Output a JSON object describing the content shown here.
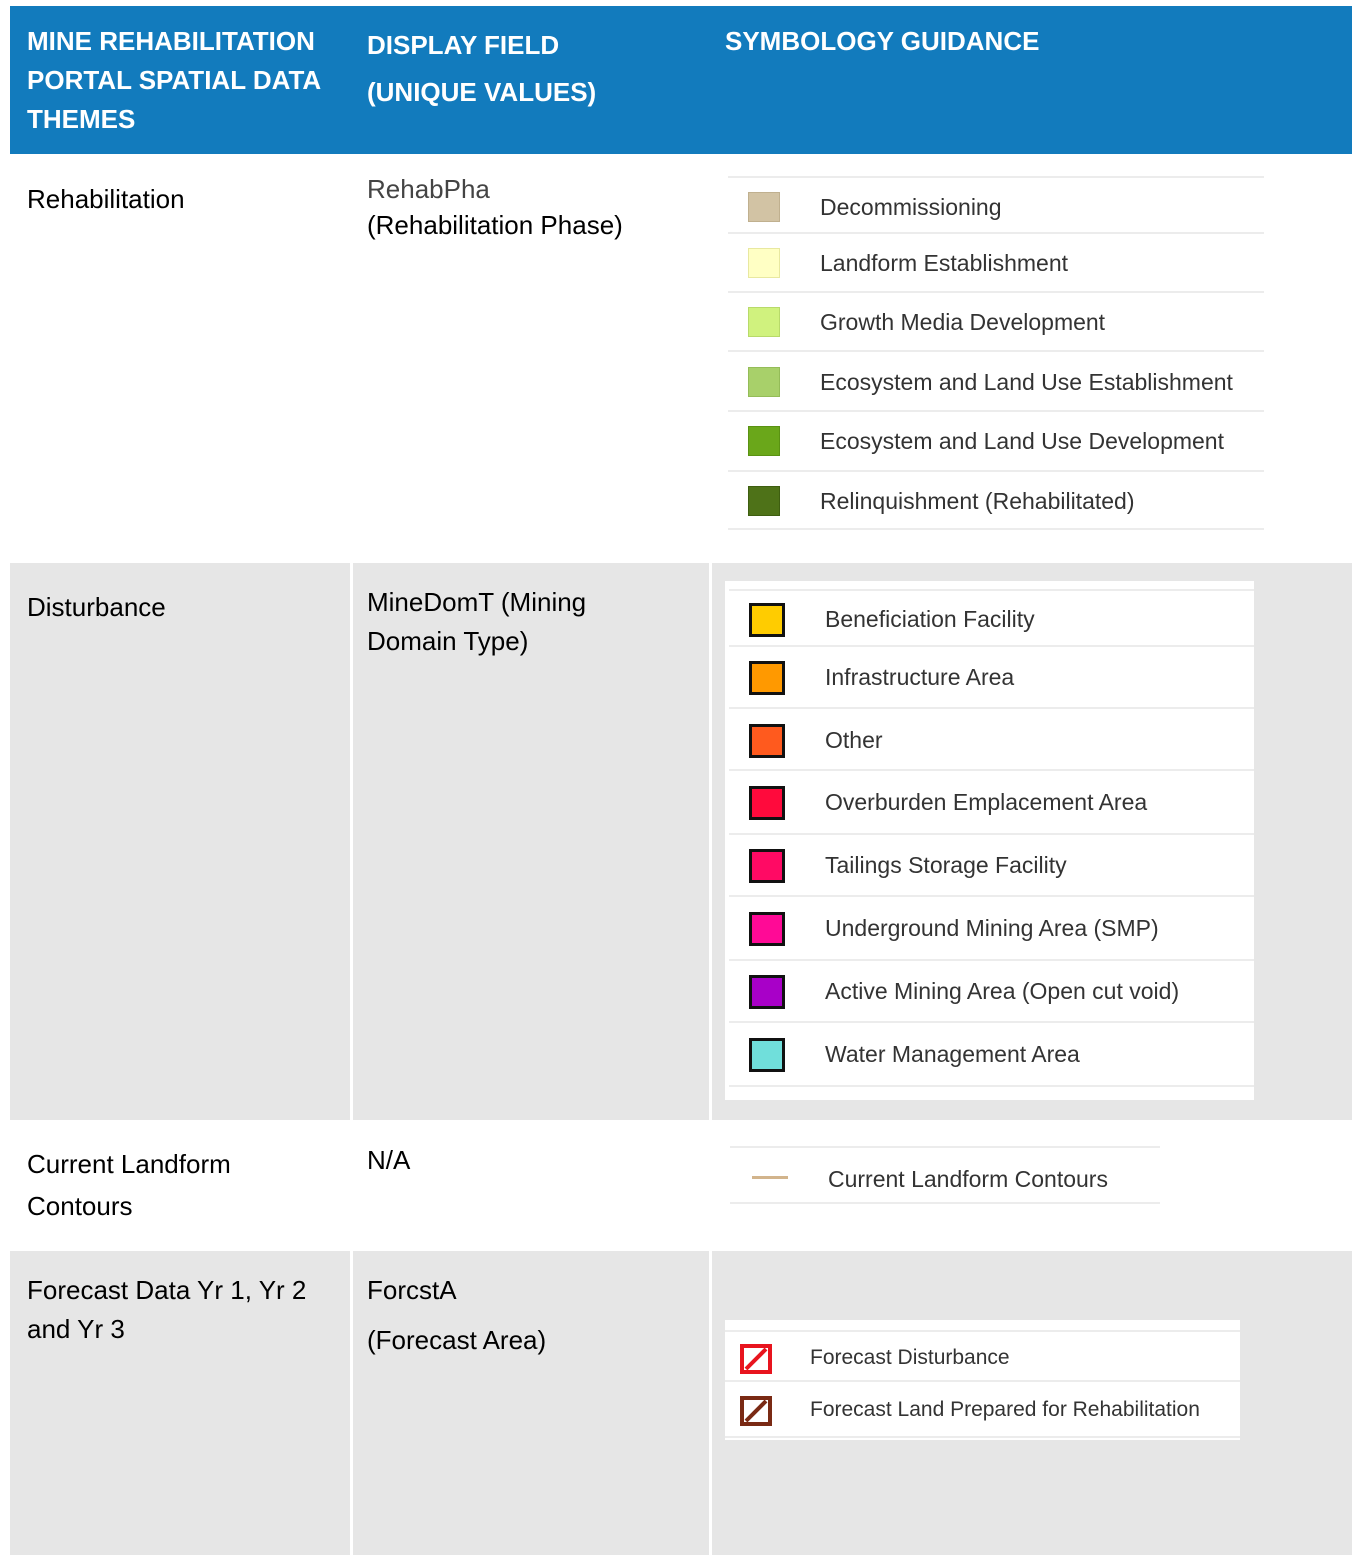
{
  "table": {
    "headers": [
      "MINE REHABILITATION PORTAL SPATIAL DATA THEMES",
      "DISPLAY FIELD (UNIQUE VALUES)",
      "SYMBOLOGY GUIDANCE"
    ],
    "rows": [
      {
        "theme": "Rehabilitation",
        "field_line1": "RehabPha",
        "field_line2": "(Rehabilitation Phase)",
        "legend": [
          {
            "label": "Decommissioning",
            "icon": "swatch-fill",
            "color": "#d2c3a4"
          },
          {
            "label": "Landform Establishment",
            "icon": "swatch-fill",
            "color": "#ffffc4"
          },
          {
            "label": "Growth Media Development",
            "icon": "swatch-fill",
            "color": "#d0f27e"
          },
          {
            "label": "Ecosystem and Land Use Establishment",
            "icon": "swatch-fill",
            "color": "#a8d06a"
          },
          {
            "label": "Ecosystem and Land Use Development",
            "icon": "swatch-fill",
            "color": "#6aa71a"
          },
          {
            "label": "Relinquishment (Rehabilitated)",
            "icon": "swatch-fill",
            "color": "#4e7218"
          }
        ]
      },
      {
        "theme": "Disturbance",
        "field_line1": "MineDomT (Mining",
        "field_line2": "Domain Type)",
        "legend": [
          {
            "label": "Beneficiation Facility",
            "icon": "swatch-outlined",
            "color": "#ffcc00"
          },
          {
            "label": "Infrastructure Area",
            "icon": "swatch-outlined",
            "color": "#ff9900"
          },
          {
            "label": "Other",
            "icon": "swatch-outlined",
            "color": "#ff5a1e"
          },
          {
            "label": "Overburden Emplacement Area",
            "icon": "swatch-outlined",
            "color": "#ff0a3c"
          },
          {
            "label": "Tailings Storage Facility",
            "icon": "swatch-outlined",
            "color": "#ff0a64"
          },
          {
            "label": "Underground Mining Area (SMP)",
            "icon": "swatch-outlined",
            "color": "#ff0a96"
          },
          {
            "label": "Active Mining Area (Open cut void)",
            "icon": "swatch-outlined",
            "color": "#a800c8"
          },
          {
            "label": "Water Management Area",
            "icon": "swatch-outlined",
            "color": "#70dfdb"
          }
        ]
      },
      {
        "theme_line1": "Current Landform",
        "theme_line2": "Contours",
        "field": "N/A",
        "legend": [
          {
            "label": "Current Landform Contours",
            "icon": "line-symbol",
            "color": "#d2b48c"
          }
        ]
      },
      {
        "theme_line1": "Forecast Data Yr 1, Yr 2",
        "theme_line2": "and Yr 3",
        "field_line1": "ForcstA",
        "field_line2": "(Forecast Area)",
        "legend": [
          {
            "label": "Forecast Disturbance",
            "icon": "hatched-swatch",
            "color": "#e8141e"
          },
          {
            "label": "Forecast Land Prepared for Rehabilitation",
            "icon": "hatched-swatch",
            "color": "#7a2a14"
          }
        ]
      }
    ]
  }
}
